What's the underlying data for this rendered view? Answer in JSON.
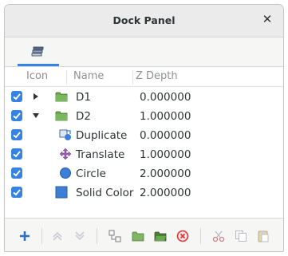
{
  "window": {
    "title": "Dock Panel"
  },
  "tab": {
    "icon": "layers-icon"
  },
  "columns": {
    "icon": "Icon",
    "name": "Name",
    "zdepth": "Z Depth"
  },
  "rows": [
    {
      "name": "D1",
      "z": "0.000000",
      "checked": true,
      "expander": "collapsed",
      "icon": "folder-icon"
    },
    {
      "name": "D2",
      "z": "1.000000",
      "checked": true,
      "expander": "expanded",
      "icon": "folder-icon"
    },
    {
      "name": "Duplicate",
      "z": "0.000000",
      "checked": true,
      "icon": "duplicate-icon"
    },
    {
      "name": "Translate",
      "z": "1.000000",
      "checked": true,
      "icon": "translate-icon"
    },
    {
      "name": "Circle",
      "z": "2.000000",
      "checked": true,
      "icon": "circle-icon"
    },
    {
      "name": "Solid Color",
      "z": "2.000000",
      "checked": true,
      "icon": "solid-color-icon"
    }
  ],
  "toolbar": [
    "add-icon",
    "move-up-icon",
    "move-down-icon",
    "group-icon",
    "new-folder-icon",
    "open-folder-icon",
    "delete-icon",
    "cut-icon",
    "copy-icon",
    "paste-icon"
  ],
  "colors": {
    "accent": "#3584e4",
    "folder": "#6aa84f",
    "shape": "#3d7fd6"
  }
}
